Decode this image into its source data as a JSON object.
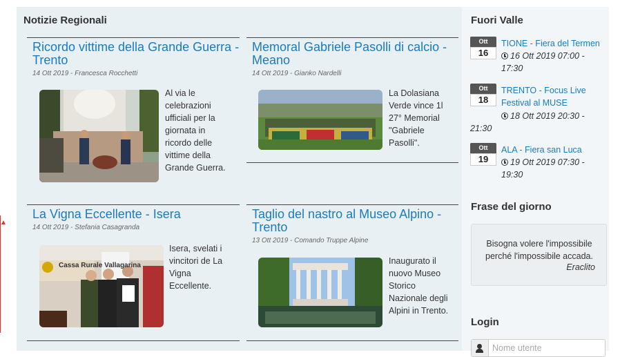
{
  "main": {
    "heading": "Notizie Regionali",
    "articles": [
      {
        "title": "Ricordo vittime della Grande Guerra - Trento",
        "meta": "14 Ott 2019 - Francesca Rocchetti",
        "blurb": "Al via le celebrazioni ufficiali per la giornata in ricordo delle vittime della Grande Guerra."
      },
      {
        "title": "Memoral Gabriele Pasolli di calcio - Meano",
        "meta": "14 Ott 2019 - Gianko Nardelli",
        "blurb": "La Dolasiana Verde vince 1l 27° Memorial \"Gabriele Pasolli\"."
      },
      {
        "title": "La Vigna Eccellente - Isera",
        "meta": "14 Ott 2019 - Stefania Casagranda",
        "blurb": "Isera, svelati i vincitori de La Vigna Eccellente.",
        "image_text": "Cassa Rurale Vallagarina"
      },
      {
        "title": "Taglio del nastro al Museo Alpino - Trento",
        "meta": "13 Ott 2019 - Comando Truppe Alpine",
        "blurb": "Inaugurato il nuovo Museo Storico Nazionale degli Alpini in Trento."
      }
    ]
  },
  "sidebar": {
    "fuori_valle_heading": "Fuori Valle",
    "events": [
      {
        "month": "Ott",
        "day": "16",
        "title": "TIONE - Fiera del Termen",
        "time": "16 Ott 2019 07:00 - 17:30"
      },
      {
        "month": "Ott",
        "day": "18",
        "title": "TRENTO - Focus Live Festival al MUSE",
        "time": "18 Ott 2019 20:30 - 21:30"
      },
      {
        "month": "Ott",
        "day": "19",
        "title": "ALA - Fiera san Luca",
        "time": "19 Ott 2019 07:30 - 19:30"
      }
    ],
    "frase_heading": "Frase del giorno",
    "quote": "Bisogna volere l'impossibile perché l'impossibile accada.",
    "quote_author": "Eraclito",
    "login_heading": "Login",
    "username_placeholder": "Nome utente"
  }
}
